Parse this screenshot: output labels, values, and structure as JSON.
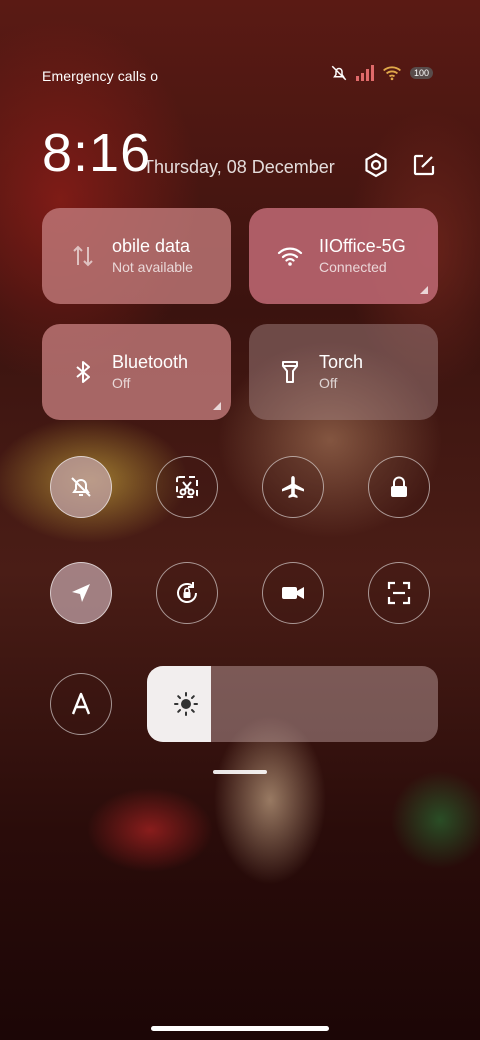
{
  "status": {
    "left_text": "Emergency calls o",
    "battery": "100"
  },
  "header": {
    "time": "8:16",
    "date": "Thursday, 08 December"
  },
  "tiles": [
    {
      "title": "obile data",
      "subtitle": "Not available",
      "state": "inactive",
      "icon": "mobile-data-icon"
    },
    {
      "title": "IIOffice-5G",
      "subtitle": "Connected",
      "state": "active",
      "icon": "wifi-icon"
    },
    {
      "title": "Bluetooth",
      "subtitle": "Off",
      "state": "inactive",
      "icon": "bluetooth-icon"
    },
    {
      "title": "Torch",
      "subtitle": "Off",
      "state": "dim",
      "icon": "torch-icon"
    }
  ],
  "toggles": [
    {
      "name": "mute-toggle",
      "icon": "bell-off-icon",
      "on": true
    },
    {
      "name": "screenshot-toggle",
      "icon": "scissors-icon",
      "on": false
    },
    {
      "name": "airplane-toggle",
      "icon": "airplane-icon",
      "on": false
    },
    {
      "name": "lock-toggle",
      "icon": "lock-icon",
      "on": false
    },
    {
      "name": "location-toggle",
      "icon": "location-icon",
      "on": true
    },
    {
      "name": "rotation-lock-toggle",
      "icon": "rotation-lock-icon",
      "on": false
    },
    {
      "name": "screen-record-toggle",
      "icon": "video-icon",
      "on": false
    },
    {
      "name": "scanner-toggle",
      "icon": "scan-icon",
      "on": false
    },
    {
      "name": "auto-text-toggle",
      "icon": "font-a-icon",
      "on": false
    }
  ],
  "brightness": {
    "level": 0.22
  },
  "colors": {
    "active_tile": "#b7646e",
    "brightness_fill": "#f2eeee"
  }
}
